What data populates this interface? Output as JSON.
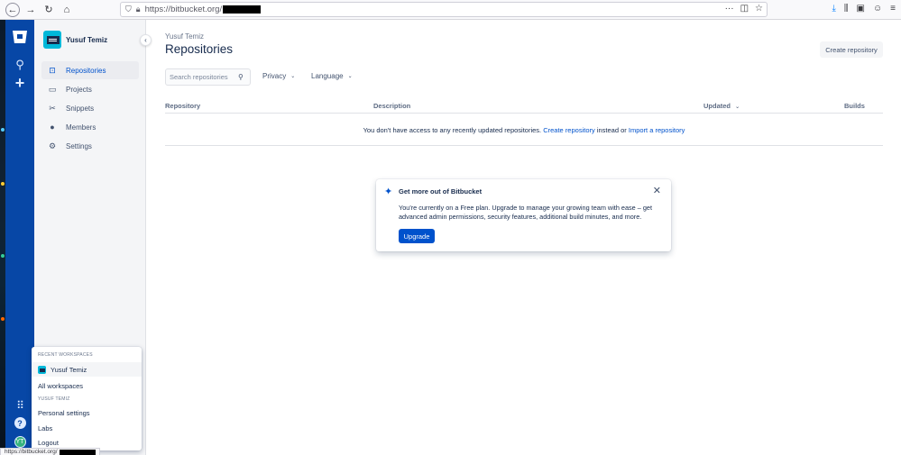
{
  "browser": {
    "url": "https://bitbucket.org/",
    "back_icon": "back-arrow-icon",
    "forward_icon": "forward-arrow-icon",
    "reload_icon": "reload-icon",
    "home_icon": "home-icon",
    "right_icons": [
      "page-actions-icon",
      "pocket-icon",
      "bookmark-star-icon",
      "downloads-icon",
      "library-icon",
      "sidebar-icon",
      "account-icon",
      "menu-icon"
    ],
    "status_url": "https://bitbucket.org/"
  },
  "global_nav": {
    "icons": [
      "bitbucket-logo-icon",
      "search-icon",
      "create-plus-icon",
      "app-switcher-icon",
      "help-icon",
      "user-avatar-icon"
    ],
    "help_glyph": "?",
    "avatar_initials": "YT",
    "accent": "#0747a6"
  },
  "sidebar": {
    "workspace_name": "Yusuf Temiz",
    "items": [
      {
        "label": "Repositories",
        "icon": "repositories-icon",
        "active": true
      },
      {
        "label": "Projects",
        "icon": "projects-folder-icon",
        "active": false
      },
      {
        "label": "Snippets",
        "icon": "snippets-scissors-icon",
        "active": false
      },
      {
        "label": "Members",
        "icon": "members-icon",
        "active": false
      },
      {
        "label": "Settings",
        "icon": "settings-gear-icon",
        "active": false
      }
    ]
  },
  "dropdown": {
    "recent_heading": "RECENT WORKSPACES",
    "recent_workspace": "Yusuf Temiz",
    "all_workspaces": "All workspaces",
    "user_heading": "YUSUF TEMIZ",
    "personal_settings": "Personal settings",
    "labs": "Labs",
    "logout": "Logout"
  },
  "main": {
    "breadcrumb": "Yusuf Temiz",
    "title": "Repositories",
    "create_button": "Create repository",
    "search_placeholder": "Search repositories",
    "filters": [
      "Privacy",
      "Language"
    ],
    "columns": {
      "repository": "Repository",
      "description": "Description",
      "updated": "Updated",
      "builds": "Builds"
    },
    "empty": {
      "prefix": "You don't have access to any recently updated repositories.",
      "create_link": "Create repository",
      "middle": "instead or",
      "import_link": "Import a repository"
    }
  },
  "upgrade_card": {
    "title": "Get more out of Bitbucket",
    "body": "You're currently on a Free plan. Upgrade to manage your growing team with ease – get advanced admin permissions, security features, additional build minutes, and more.",
    "button": "Upgrade",
    "icon": "sparkle-icon",
    "close_icon": "close-icon"
  },
  "colors": {
    "link": "#0052cc",
    "primary_button": "#0052cc",
    "text": "#172b4d"
  }
}
